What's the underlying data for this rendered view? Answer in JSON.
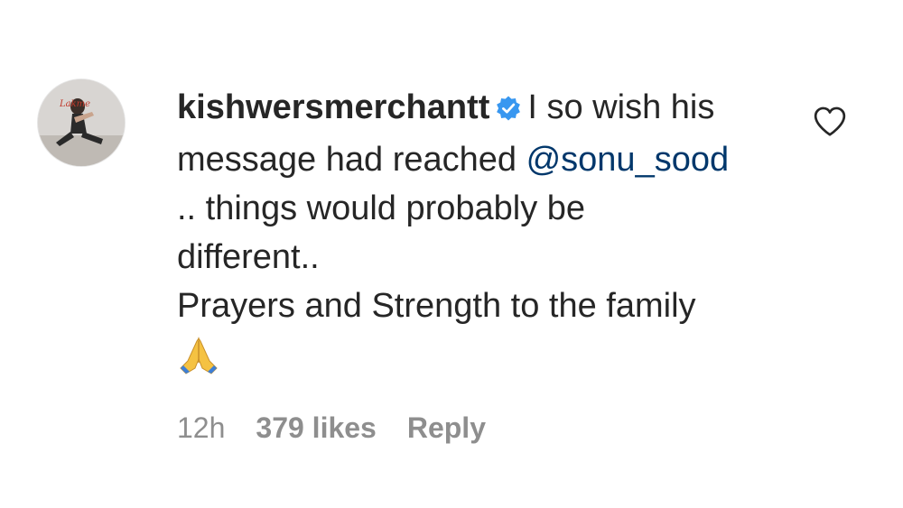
{
  "comment": {
    "username": "kishwersmerchantt",
    "verified_icon": "verified-badge-icon",
    "text_line1": "I so wish his",
    "text_line2_prefix": "message had reached ",
    "mention": "@sonu_sood",
    "text_line3": ".. things would probably be",
    "text_line4": "different..",
    "text_line5": "Prayers and Strength to the family",
    "emoji_icon": "folded-hands-icon",
    "avatar_caption": "Lakme",
    "time": "12h",
    "likes": "379 likes",
    "reply_label": "Reply",
    "like_icon": "heart-outline-icon"
  },
  "colors": {
    "text": "#262626",
    "muted": "#8e8e8e",
    "mention": "#00376b",
    "verified": "#3897f0"
  }
}
